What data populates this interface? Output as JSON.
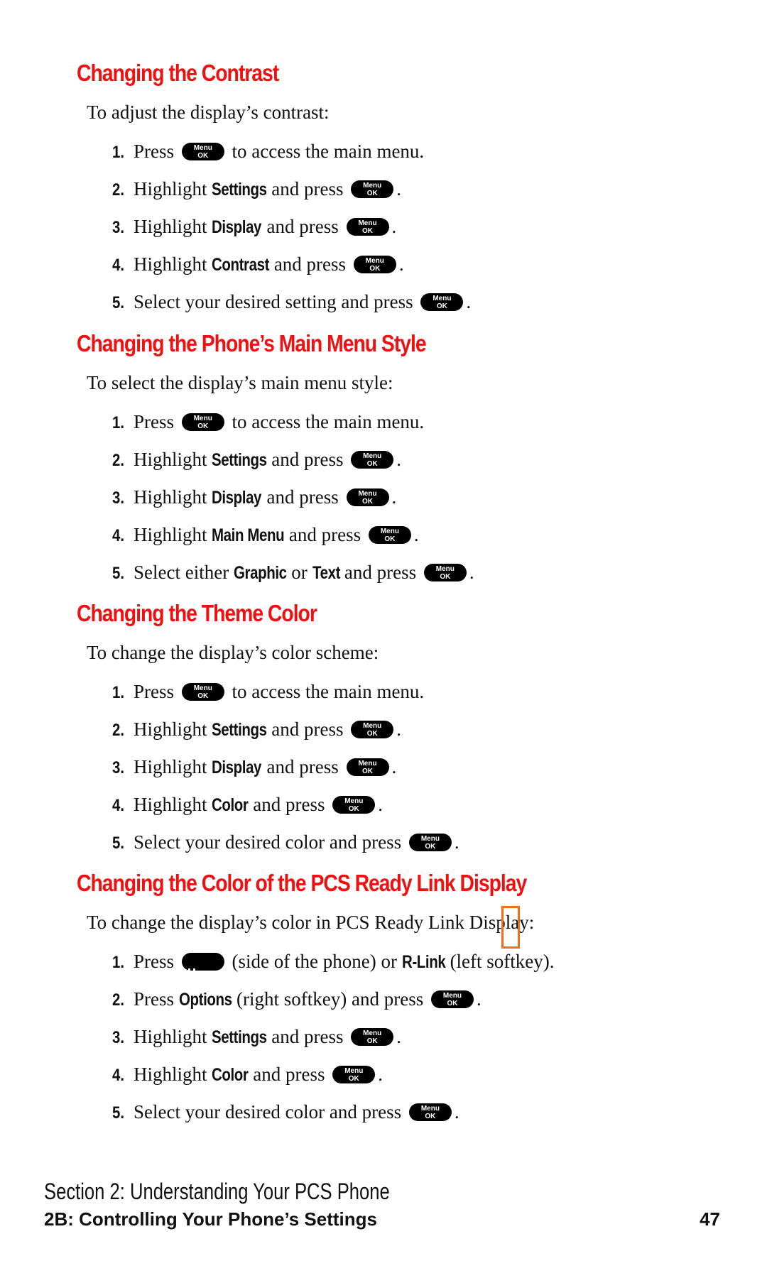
{
  "key_icon": {
    "line1": "Menu",
    "line2": "OK"
  },
  "sections": [
    {
      "title": "Changing the Contrast",
      "intro": "To adjust the display’s contrast:",
      "steps": [
        {
          "num": "1.",
          "parts": [
            "Press ",
            "{key}",
            " to access the main menu."
          ]
        },
        {
          "num": "2.",
          "parts": [
            "Highlight ",
            "*Settings",
            " and press ",
            "{key}",
            "."
          ]
        },
        {
          "num": "3.",
          "parts": [
            "Highlight ",
            "*Display",
            " and press ",
            "{key}",
            "."
          ]
        },
        {
          "num": "4.",
          "parts": [
            "Highlight ",
            "*Contrast",
            " and press ",
            "{key}",
            "."
          ]
        },
        {
          "num": "5.",
          "parts": [
            "Select your desired setting and press ",
            "{key}",
            "."
          ]
        }
      ]
    },
    {
      "title": "Changing the Phone’s Main Menu Style",
      "intro": "To select the display’s main menu style:",
      "steps": [
        {
          "num": "1.",
          "parts": [
            "Press ",
            "{key}",
            " to access the main menu."
          ]
        },
        {
          "num": "2.",
          "parts": [
            "Highlight ",
            "*Settings",
            " and press ",
            "{key}",
            "."
          ]
        },
        {
          "num": "3.",
          "parts": [
            "Highlight ",
            "*Display",
            " and press ",
            "{key}",
            "."
          ]
        },
        {
          "num": "4.",
          "parts": [
            "Highlight ",
            "*Main Menu",
            " and press ",
            "{key}",
            "."
          ]
        },
        {
          "num": "5.",
          "parts": [
            "Select either ",
            "*Graphic",
            " or ",
            "*Text",
            " and press ",
            "{key}",
            "."
          ]
        }
      ]
    },
    {
      "title": "Changing the Theme Color",
      "intro": "To change the display’s color scheme:",
      "steps": [
        {
          "num": "1.",
          "parts": [
            "Press ",
            "{key}",
            " to access the main menu."
          ]
        },
        {
          "num": "2.",
          "parts": [
            "Highlight ",
            "*Settings",
            " and press ",
            "{key}",
            "."
          ]
        },
        {
          "num": "3.",
          "parts": [
            "Highlight ",
            "*Display",
            " and press ",
            "{key}",
            "."
          ]
        },
        {
          "num": "4.",
          "parts": [
            "Highlight ",
            "*Color",
            " and press ",
            "{key}",
            "."
          ]
        },
        {
          "num": "5.",
          "parts": [
            "Select your desired color and press ",
            "{key}",
            "."
          ]
        }
      ]
    },
    {
      "title": "Changing the Color of the PCS Ready Link Display",
      "intro": "To change the display’s color in PCS Ready Link Display:",
      "steps": [
        {
          "num": "1.",
          "parts": [
            "Press ",
            "{side}",
            " (side of the phone) or ",
            "*R-Link",
            " (left softkey)."
          ]
        },
        {
          "num": "2.",
          "parts": [
            "Press ",
            "*Options",
            " (right softkey) and press ",
            "{key}",
            "."
          ]
        },
        {
          "num": "3.",
          "parts": [
            "Highlight ",
            "*Settings",
            " and press ",
            "{key}",
            "."
          ]
        },
        {
          "num": "4.",
          "parts": [
            "Highlight ",
            "*Color",
            " and press ",
            "{key}",
            "."
          ]
        },
        {
          "num": "5.",
          "parts": [
            "Select your desired color and press ",
            "{key}",
            "."
          ]
        }
      ]
    }
  ],
  "icons": {
    "menu_key": "menu-ok-key-icon",
    "side_key": "ready-link-side-key-icon"
  },
  "colors": {
    "heading": "#ee1111",
    "highlight_box": "#f07018",
    "text": "#111111"
  },
  "footer": {
    "section": "Section 2: Understanding Your PCS Phone",
    "chapter": "2B: Controlling Your Phone’s Settings",
    "page_number": "47"
  }
}
